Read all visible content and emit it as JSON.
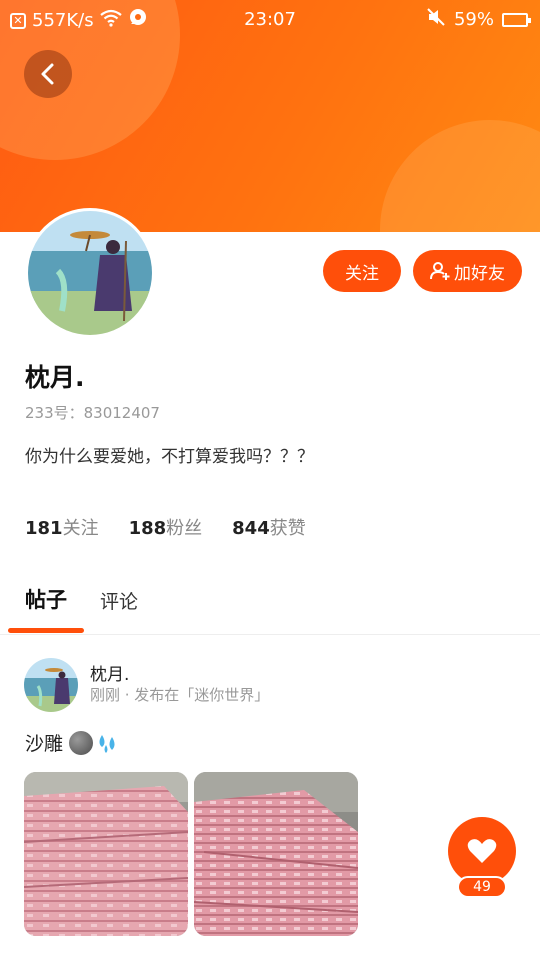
{
  "status_bar": {
    "network_speed": "557K/s",
    "time": "23:07",
    "battery": "59%",
    "battery_level": 0.59,
    "icons": [
      "notification-x-icon",
      "wifi-icon",
      "chat-bubble-icon",
      "mute-icon",
      "battery-icon"
    ]
  },
  "colors": {
    "accent": "#ff4f0a",
    "header_gradient_start": "#ff5a12",
    "header_gradient_end": "#ff8a12"
  },
  "header": {
    "back_icon": "chevron-left-icon"
  },
  "profile": {
    "name": "枕月.",
    "id_line": "233号：83012407",
    "bio": "你为什么要爱她，不打算爱我吗？？？",
    "follow_label": "关注",
    "add_friend_label": "加好友",
    "add_friend_icon": "add-user-icon"
  },
  "stats": [
    {
      "value": "181",
      "label": "关注"
    },
    {
      "value": "188",
      "label": "粉丝"
    },
    {
      "value": "844",
      "label": "获赞"
    }
  ],
  "tabs": [
    {
      "label": "帖子",
      "active": true
    },
    {
      "label": "评论",
      "active": false
    }
  ],
  "post": {
    "author": "枕月.",
    "meta": "刚刚 · 发布在「迷你世界」",
    "text": "沙雕",
    "emojis": [
      "moon-emoji",
      "sweat-droplets-emoji"
    ],
    "like_count": "49",
    "like_icon": "heart-icon"
  }
}
